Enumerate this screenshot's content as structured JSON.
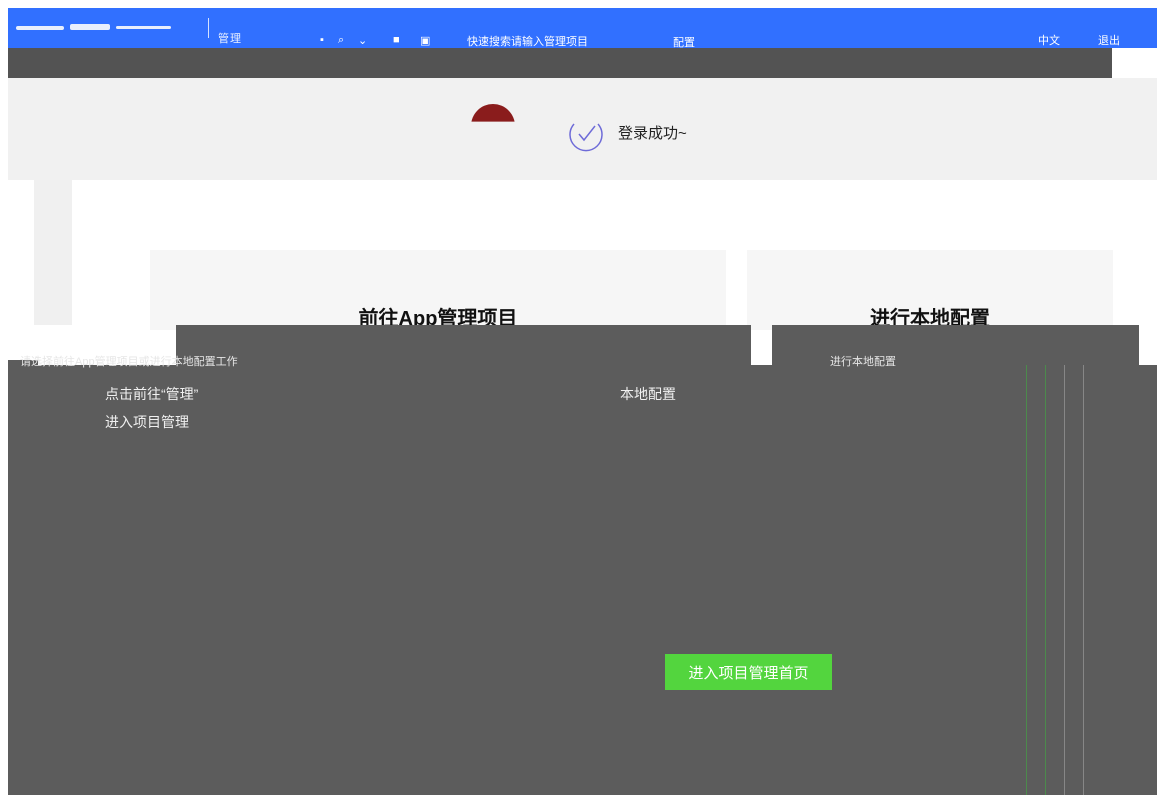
{
  "header": {
    "title": "管理",
    "tools": [
      "▪",
      "⌕",
      "⌄",
      "■",
      "▣"
    ],
    "links_text": "快速搜索请输入管理项目",
    "config_text": "配置",
    "right_item_1": "中文",
    "right_item_2": "退出"
  },
  "message": {
    "text": "登录成功~"
  },
  "cards": {
    "app_manage_title": "前往App管理项目",
    "local_config_title": "进行本地配置"
  },
  "overlay": {
    "desc_left": "请选择前往App管理项目或进行本地配置工作",
    "line1": "点击前往“管理”",
    "line2": "进入项目管理",
    "line3": "本地配置",
    "desc_right": "进行本地配置",
    "enter_button": "进入项目管理首页"
  },
  "colors": {
    "header_blue": "#3170ff",
    "button_green": "#53d53e",
    "overlay_gray": "#5c5c5c"
  }
}
